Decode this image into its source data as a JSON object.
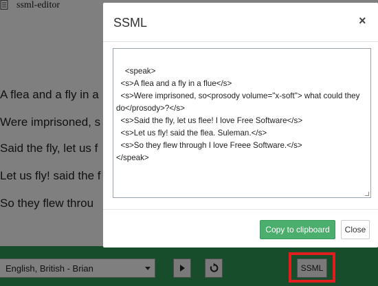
{
  "app": {
    "title": "ssml-editor"
  },
  "editor": {
    "lines": [
      "A flea and a fly in a",
      "Were imprisoned, s",
      "Said the fly, let us f",
      "Let us fly! said the f",
      "So they flew throu"
    ]
  },
  "toolbar": {
    "voice_selected": "English, British - Brian",
    "play_icon": "play-icon",
    "reset_icon": "reset-icon",
    "ssml_label": "SSML"
  },
  "modal": {
    "title": "SSML",
    "close_symbol": "×",
    "content": "<speak>\n  <s>A flea and a fly in a flue</s>\n  <s>Were imprisoned, so<prosody volume=\"x-soft\"> what could they do</prosody>?</s>\n  <s>Said the fly, let us flee! I love Free Software</s>\n  <s>Let us fly! said the flea. Suleman.</s>\n  <s>So they flew through I love Freee Software.</s>\n</speak>",
    "copy_label": "Copy to clipboard",
    "close_label": "Close"
  },
  "colors": {
    "accent_green": "#2f9a55",
    "button_green": "#4cae6d",
    "highlight_red": "#e01e1e"
  }
}
